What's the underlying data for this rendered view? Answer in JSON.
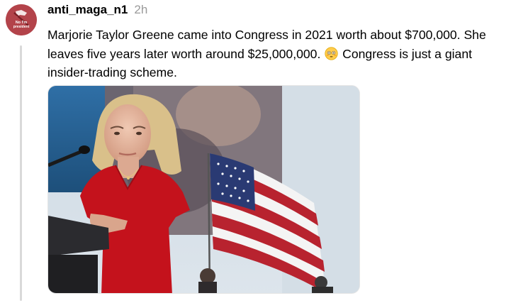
{
  "post": {
    "username": "anti_maga_n1",
    "timestamp": "2h",
    "text_before_emoji": "Marjorie Taylor Greene came into Congress in 2021 worth about $700,000. She leaves five years later worth around $25,000,000.",
    "emoji": "flushed-face",
    "text_after_emoji": "Congress is just a giant insider-trading scheme."
  },
  "avatar": {
    "lettering": "No I'm president",
    "background": "#b3434a"
  },
  "colors": {
    "thread_line": "#d9d9d9",
    "timestamp": "#9a9a9a",
    "dress_red": "#c4121c"
  }
}
